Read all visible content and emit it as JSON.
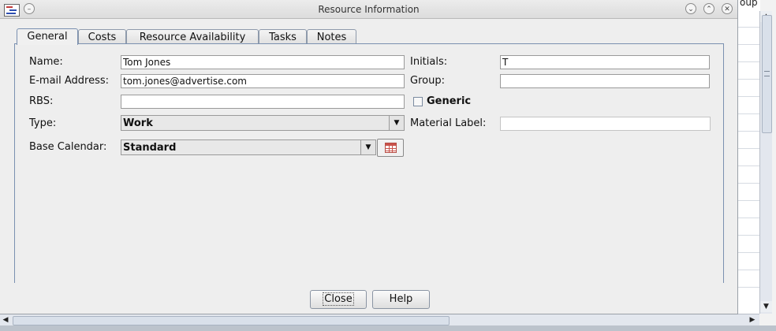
{
  "background_app": {
    "column_header": "oup"
  },
  "dialog": {
    "title": "Resource Information",
    "tabs": [
      {
        "label": "General",
        "active": true
      },
      {
        "label": "Costs",
        "active": false
      },
      {
        "label": "Resource Availability",
        "active": false
      },
      {
        "label": "Tasks",
        "active": false
      },
      {
        "label": "Notes",
        "active": false
      }
    ],
    "form": {
      "name_label": "Name:",
      "name_value": "Tom Jones",
      "email_label": "E-mail Address:",
      "email_value": "tom.jones@advertise.com",
      "rbs_label": "RBS:",
      "rbs_value": "",
      "type_label": "Type:",
      "type_value": "Work",
      "base_calendar_label": "Base Calendar:",
      "base_calendar_value": "Standard",
      "initials_label": "Initials:",
      "initials_value": "T",
      "group_label": "Group:",
      "group_value": "",
      "generic_label": "Generic",
      "generic_checked": false,
      "material_label_label": "Material Label:",
      "material_label_value": ""
    },
    "buttons": {
      "close": "Close",
      "help": "Help"
    }
  },
  "colors": {
    "tab_border": "#7a90b0",
    "calendar_icon": "#c9534b"
  }
}
